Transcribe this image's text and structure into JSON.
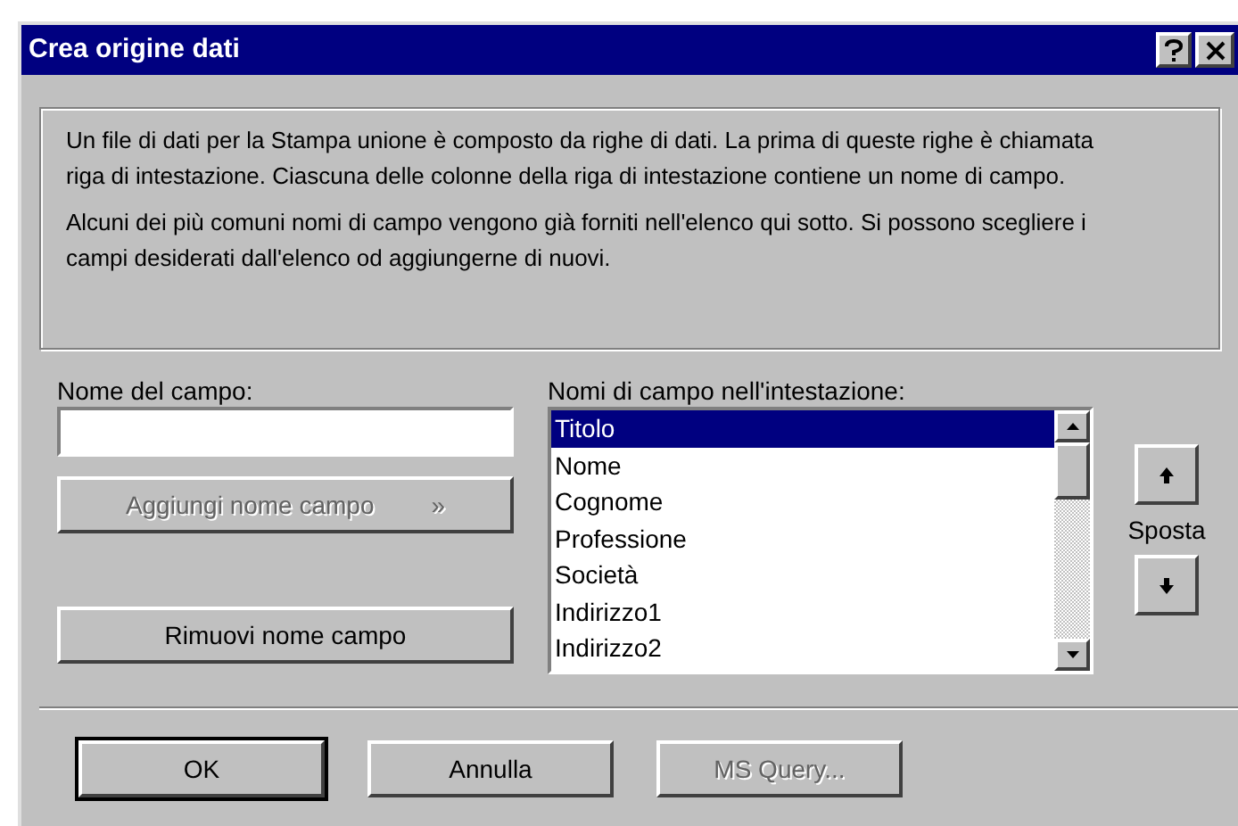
{
  "window": {
    "title": "Crea origine dati"
  },
  "description": [
    "Un file di dati per la Stampa unione è composto da righe di dati.  La prima di queste righe è chiamata riga di intestazione.  Ciascuna delle colonne della riga di intestazione contiene un nome di campo.",
    "Alcuni dei più comuni nomi di campo vengono già forniti nell'elenco qui sotto. Si possono scegliere i campi desiderati dall'elenco od aggiungerne di nuovi."
  ],
  "field_name": {
    "label": "Nome del campo:"
  },
  "add_button": {
    "label": "Aggiungi nome campo",
    "glyph": "»",
    "disabled": true
  },
  "remove_button": {
    "label": "Rimuovi nome campo",
    "disabled": false
  },
  "header_fields": {
    "label": "Nomi di campo nell'intestazione:",
    "items": [
      {
        "label": "Titolo",
        "selected": true
      },
      {
        "label": "Nome",
        "selected": false
      },
      {
        "label": "Cognome",
        "selected": false
      },
      {
        "label": "Professione",
        "selected": false
      },
      {
        "label": "Società",
        "selected": false
      },
      {
        "label": "Indirizzo1",
        "selected": false
      },
      {
        "label": "Indirizzo2",
        "selected": false
      }
    ]
  },
  "move": {
    "label": "Sposta"
  },
  "buttons": [
    {
      "label": "OK",
      "default": true,
      "disabled": false
    },
    {
      "label": "Annulla",
      "default": false,
      "disabled": false
    },
    {
      "label": "MS Query...",
      "default": false,
      "disabled": true
    }
  ]
}
